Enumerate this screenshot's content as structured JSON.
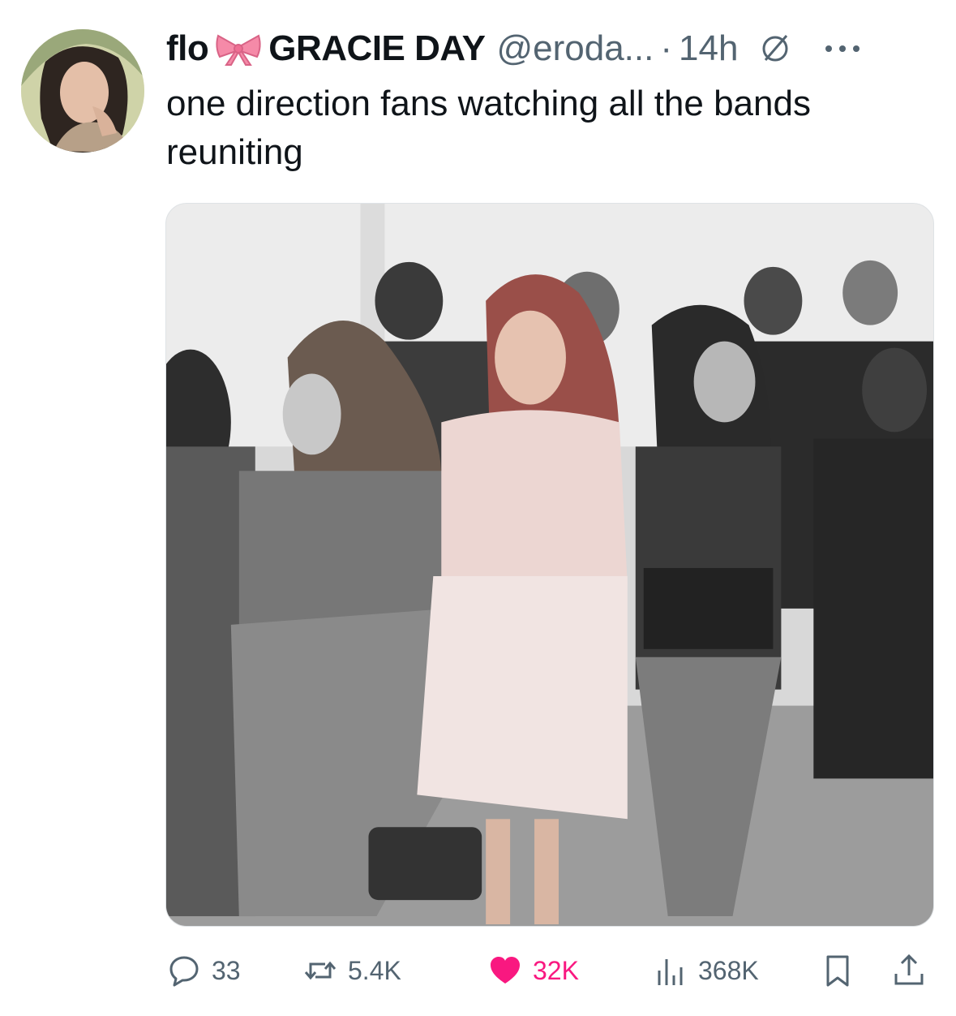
{
  "tweet": {
    "display_name": "flo",
    "display_name_suffix": "GRACIE DAY",
    "handle": "@eroda...",
    "separator": "·",
    "time": "14h",
    "text": "one direction fans watching all the bands reuniting"
  },
  "icons": {
    "avatar": "avatar-photo",
    "bow": "pink-bow-emoji",
    "status": "no-sign-icon",
    "more": "more-dots-icon",
    "reply": "reply-icon",
    "retweet": "retweet-icon",
    "like": "heart-icon",
    "views": "views-bar-icon",
    "bookmark": "bookmark-icon",
    "share": "share-icon"
  },
  "actions": {
    "replies": "33",
    "retweets": "5.4K",
    "likes": "32K",
    "views": "368K"
  },
  "colors": {
    "text": "#0f1419",
    "muted": "#536471",
    "like": "#f91880",
    "bow": "#f58aa8"
  }
}
